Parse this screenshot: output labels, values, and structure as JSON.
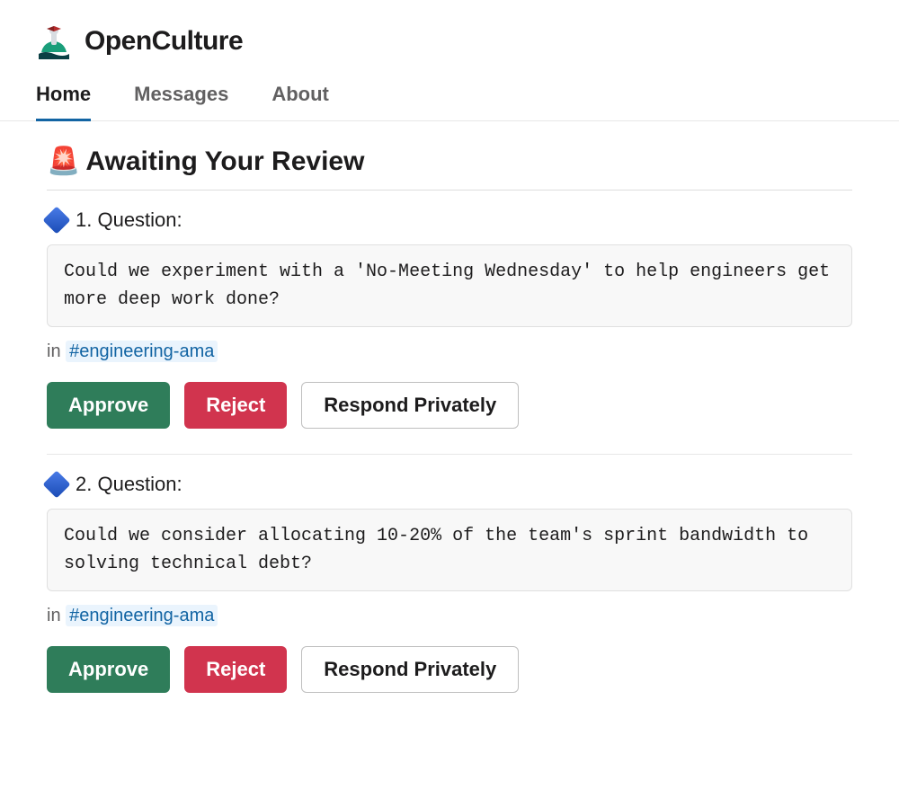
{
  "header": {
    "title": "OpenCulture"
  },
  "tabs": {
    "home": "Home",
    "messages": "Messages",
    "about": "About"
  },
  "section": {
    "title": "Awaiting Your Review",
    "icon": "🚨"
  },
  "labels": {
    "in": "in",
    "approve": "Approve",
    "reject": "Reject",
    "respond_private": "Respond Privately"
  },
  "items": [
    {
      "index": "1",
      "label_suffix": ". Question:",
      "body": "Could we experiment with a 'No-Meeting Wednesday' to help engineers get more deep work done?",
      "channel": "#engineering-ama"
    },
    {
      "index": "2",
      "label_suffix": ". Question:",
      "body": "Could we consider allocating 10-20% of the team's sprint bandwidth to solving technical debt?",
      "channel": "#engineering-ama"
    }
  ]
}
